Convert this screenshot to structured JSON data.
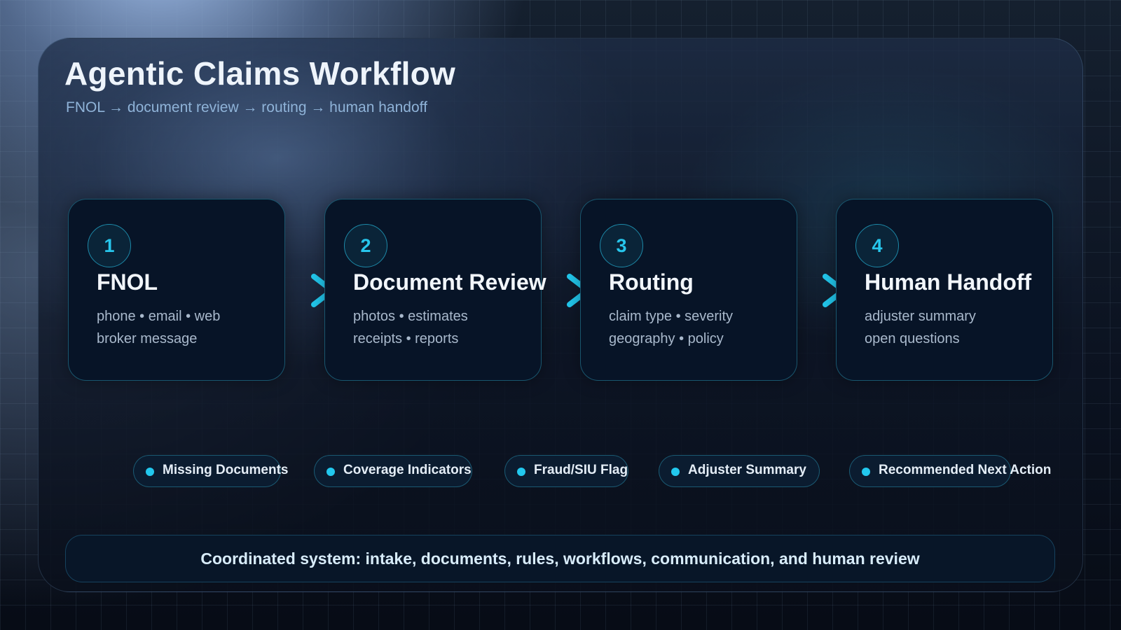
{
  "header": {
    "title": "Agentic Claims Workflow",
    "subtitle": "FNOL → document review → routing → human handoff"
  },
  "steps": [
    {
      "number": "1",
      "title": "FNOL",
      "line1": "phone • email • web",
      "line2": "broker message"
    },
    {
      "number": "2",
      "title": "Document Review",
      "line1": "photos • estimates",
      "line2": "receipts • reports"
    },
    {
      "number": "3",
      "title": "Routing",
      "line1": "claim type • severity",
      "line2": "geography • policy"
    },
    {
      "number": "4",
      "title": "Human Handoff",
      "line1": "adjuster summary",
      "line2": "open questions"
    }
  ],
  "outputs": [
    "Missing Documents",
    "Coverage Indicators",
    "Fraud/SIU Flag",
    "Adjuster Summary",
    "Recommended Next Action"
  ],
  "footer": {
    "text": "Coordinated system: intake, documents, rules, workflows, communication, and human review"
  },
  "colors": {
    "accent": "#22c8ee",
    "card_bg": "#071427",
    "title": "#eef4fb",
    "subtitle": "#8fb3d8"
  },
  "icons": {
    "flow_arrow": "chevron-right-icon",
    "chip_marker": "dot-icon"
  }
}
